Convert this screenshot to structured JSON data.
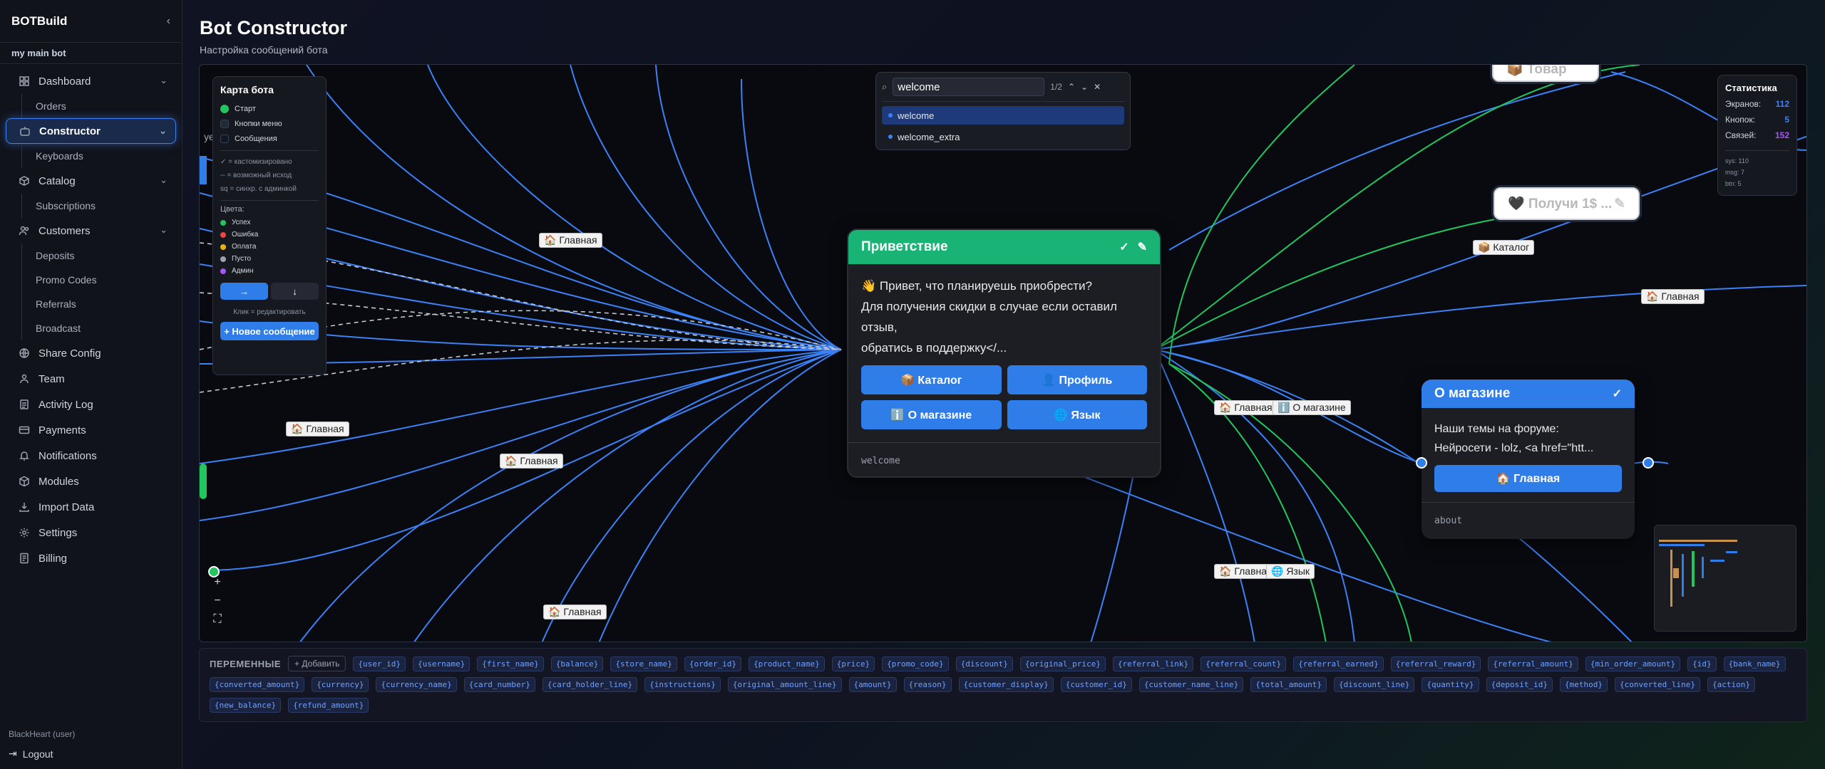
{
  "app": {
    "logo": "BOTBuild",
    "collapse_icon": "chevron-left-icon",
    "project": "my main bot"
  },
  "sidebar": {
    "items": [
      {
        "label": "Dashboard",
        "icon": "dashboard-icon",
        "expandable": true
      },
      {
        "label": "Orders",
        "sub": true
      },
      {
        "label": "Constructor",
        "icon": "bot-icon",
        "expandable": true,
        "active": true
      },
      {
        "label": "Keyboards",
        "sub": true
      },
      {
        "label": "Catalog",
        "icon": "box-icon",
        "expandable": true
      },
      {
        "label": "Subscriptions",
        "sub": true
      },
      {
        "label": "Customers",
        "icon": "users-icon",
        "expandable": true
      },
      {
        "label": "Deposits",
        "sub": true
      },
      {
        "label": "Promo Codes",
        "sub": true
      },
      {
        "label": "Referrals",
        "sub": true
      },
      {
        "label": "Broadcast",
        "sub": true
      },
      {
        "label": "Share Config",
        "icon": "globe-icon"
      },
      {
        "label": "Team",
        "icon": "team-icon"
      },
      {
        "label": "Activity Log",
        "icon": "log-icon"
      },
      {
        "label": "Payments",
        "icon": "card-icon"
      },
      {
        "label": "Notifications",
        "icon": "bell-icon"
      },
      {
        "label": "Modules",
        "icon": "modules-icon"
      },
      {
        "label": "Import Data",
        "icon": "import-icon"
      },
      {
        "label": "Settings",
        "icon": "gear-icon"
      },
      {
        "label": "Billing",
        "icon": "billing-icon"
      }
    ],
    "user": "BlackHeart (user)",
    "logout": "Logout"
  },
  "header": {
    "title": "Bot Constructor",
    "subtitle": "Настройка сообщений бота"
  },
  "bot_map": {
    "title": "Карта бота",
    "types": [
      {
        "label": "Старт",
        "color": "#22c55e"
      },
      {
        "label": "Кнопки меню",
        "color": "#1f2937"
      },
      {
        "label": "Сообщения",
        "color": "#111827"
      }
    ],
    "legend": [
      "✓ = кастомизировано",
      "-- = возможный исход",
      "sq = синхр. с админкой"
    ],
    "colors_caption": "Цвета:",
    "colors": [
      {
        "label": "Успех",
        "color": "#22c55e"
      },
      {
        "label": "Ошибка",
        "color": "#ef4444"
      },
      {
        "label": "Оплата",
        "color": "#eab308"
      },
      {
        "label": "Пусто",
        "color": "#9ca3af"
      },
      {
        "label": "Админ",
        "color": "#a855f7"
      }
    ],
    "dir_right": "→",
    "dir_down": "↓",
    "hint": "Клик = редактировать",
    "new_message": "+ Новое сообщение"
  },
  "search": {
    "value": "welcome",
    "count": "1/2",
    "results": [
      "welcome",
      "welcome_extra"
    ]
  },
  "stats": {
    "title": "Статистика",
    "rows": [
      {
        "label": "Экранов:",
        "value": "112",
        "color": "#3b82f6"
      },
      {
        "label": "Кнопок:",
        "value": "5",
        "color": "#3b82f6"
      },
      {
        "label": "Связей:",
        "value": "152",
        "color": "#a855f7"
      }
    ],
    "meta": [
      "sys: 110",
      "msg: 7",
      "btn: 5"
    ]
  },
  "nodes": {
    "welcome": {
      "title": "Приветствие",
      "text": [
        "👋 Привет, что планируешь приобрести?",
        "Для получения скидки в случае если оставил",
        "отзыв,",
        "обратись в поддержку</..."
      ],
      "buttons": [
        "📦 Каталог",
        "👤 Профиль",
        "ℹ️ О магазине",
        "🌐 Язык"
      ],
      "key": "welcome"
    },
    "about": {
      "title": "О магазине",
      "text": [
        "Наши темы на форуме:",
        "Нейросети - lolz, <a href=\"htt..."
      ],
      "button": "🏠 Главная",
      "key": "about"
    },
    "tovar": {
      "title": "📦 Товар"
    },
    "gift": {
      "title": "🖤 Получи 1$ ..."
    }
  },
  "edge_labels": [
    "🏠 Главная",
    "🏠 Главная",
    "🏠 Главная",
    "🏠 Главная",
    "📦 Каталог",
    "🏠 Главная",
    "🏠 Главная",
    "ℹ️ О магазине",
    "🏠 Главная",
    "🌐 Язык",
    "уе"
  ],
  "variables": {
    "label": "ПЕРЕМЕННЫЕ",
    "add": "+ Добавить",
    "items": [
      "{user_id}",
      "{username}",
      "{first_name}",
      "{balance}",
      "{store_name}",
      "{order_id}",
      "{product_name}",
      "{price}",
      "{promo_code}",
      "{discount}",
      "{original_price}",
      "{referral_link}",
      "{referral_count}",
      "{referral_earned}",
      "{referral_reward}",
      "{referral_amount}",
      "{min_order_amount}",
      "{id}",
      "{bank_name}",
      "{converted_amount}",
      "{currency}",
      "{currency_name}",
      "{card_number}",
      "{card_holder_line}",
      "{instructions}",
      "{original_amount_line}",
      "{amount}",
      "{reason}",
      "{customer_display}",
      "{customer_id}",
      "{customer_name_line}",
      "{total_amount}",
      "{discount_line}",
      "{quantity}",
      "{deposit_id}",
      "{method}",
      "{converted_line}",
      "{action}",
      "{new_balance}",
      "{refund_amount}"
    ]
  }
}
